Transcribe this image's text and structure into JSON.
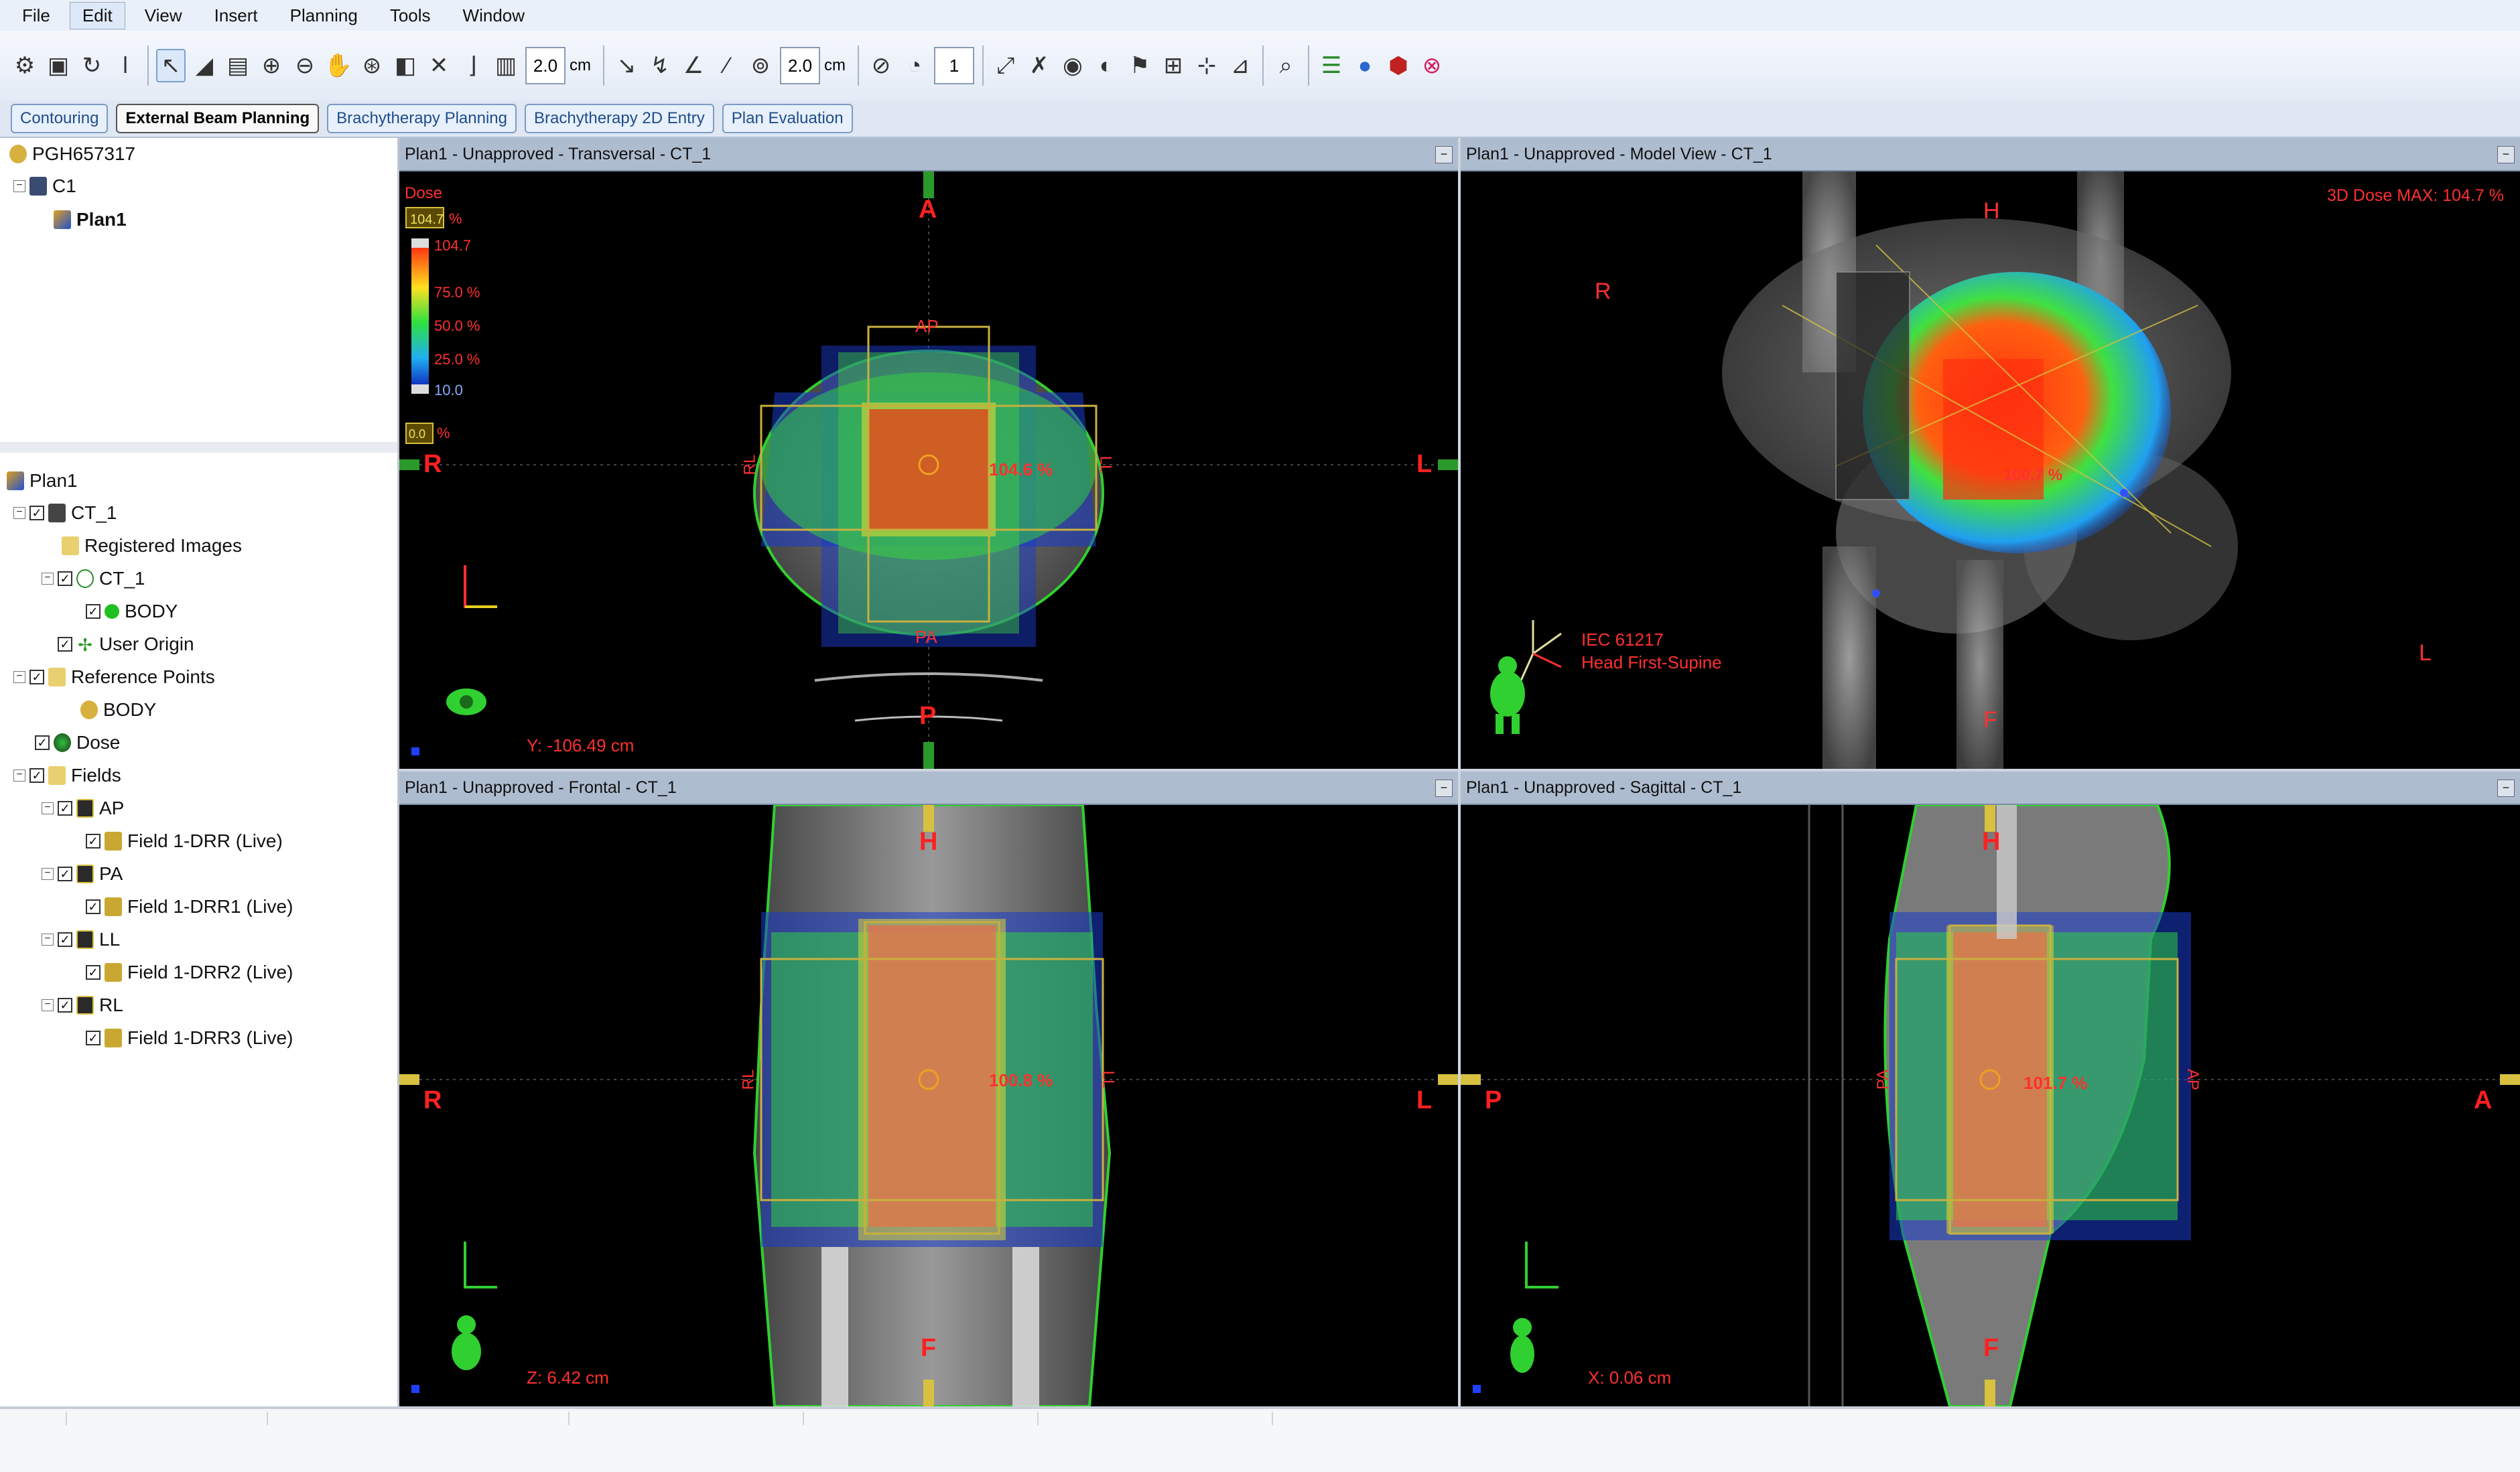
{
  "menu": [
    "File",
    "Edit",
    "View",
    "Insert",
    "Planning",
    "Tools",
    "Window"
  ],
  "toolbar": {
    "field1": "2.0",
    "unit1": "cm",
    "field2": "2.0",
    "unit2": "cm",
    "field3": "1"
  },
  "tabs": [
    "Contouring",
    "External Beam Planning",
    "Brachytherapy Planning",
    "Brachytherapy 2D Entry",
    "Plan Evaluation"
  ],
  "tree_top": {
    "patient": "PGH657317",
    "course": "C1",
    "plan": "Plan1"
  },
  "tree_bottom": [
    {
      "label": "Plan1"
    },
    {
      "label": "CT_1"
    },
    {
      "label": "Registered Images"
    },
    {
      "label": "CT_1"
    },
    {
      "label": "BODY"
    },
    {
      "label": "User Origin"
    },
    {
      "label": "Reference Points"
    },
    {
      "label": "BODY"
    },
    {
      "label": "Dose"
    },
    {
      "label": "Fields"
    },
    {
      "label": "AP"
    },
    {
      "label": "Field 1-DRR (Live)"
    },
    {
      "label": "PA"
    },
    {
      "label": "Field 1-DRR1 (Live)"
    },
    {
      "label": "LL"
    },
    {
      "label": "Field 1-DRR2 (Live)"
    },
    {
      "label": "RL"
    },
    {
      "label": "Field 1-DRR3 (Live)"
    }
  ],
  "views": {
    "transversal": {
      "title": "Plan1 - Unapproved - Transversal - CT_1",
      "dose_label": "Dose",
      "dose_max_box": "104.7",
      "pct": "%",
      "legend": [
        "104.7",
        "75.0 %",
        "50.0 %",
        "25.0 %",
        "10.0"
      ],
      "dose_min_box": "0.0",
      "point_dose": "104.6 %",
      "orient": {
        "top": "A",
        "bottom": "P",
        "left": "R",
        "right": "L"
      },
      "beam": {
        "ap": "AP",
        "pa": "PA",
        "rl": "RL",
        "ll": "LL"
      },
      "coord": "Y: -106.49 cm"
    },
    "model": {
      "title": "Plan1 - Unapproved - Model View - CT_1",
      "max_dose": "3D Dose MAX: 104.7 %",
      "orient": {
        "top": "H",
        "bottom": "F",
        "left": "R",
        "right": "L"
      },
      "standard": "IEC 61217",
      "position": "Head First-Supine",
      "point_dose": "100.7 %"
    },
    "frontal": {
      "title": "Plan1 - Unapproved - Frontal - CT_1",
      "orient": {
        "top": "H",
        "bottom": "F",
        "left": "R",
        "right": "L"
      },
      "beam": {
        "rl": "RL",
        "ll": "LL"
      },
      "point_dose": "100.8 %",
      "coord": "Z: 6.42 cm"
    },
    "sagittal": {
      "title": "Plan1 - Unapproved - Sagittal - CT_1",
      "orient": {
        "top": "H",
        "bottom": "F",
        "left": "P",
        "right": "A"
      },
      "beam": {
        "pa": "PA",
        "ap": "AP"
      },
      "point_dose": "101.7 %",
      "coord": "X: 0.06 cm"
    }
  },
  "colors": {
    "dose_red": "#e03a1a",
    "dose_yellow": "#e8e030",
    "dose_green": "#30c040",
    "dose_blue": "#2050e0",
    "orient_red": "#ff2020",
    "title_bar": "#aebcd0"
  }
}
